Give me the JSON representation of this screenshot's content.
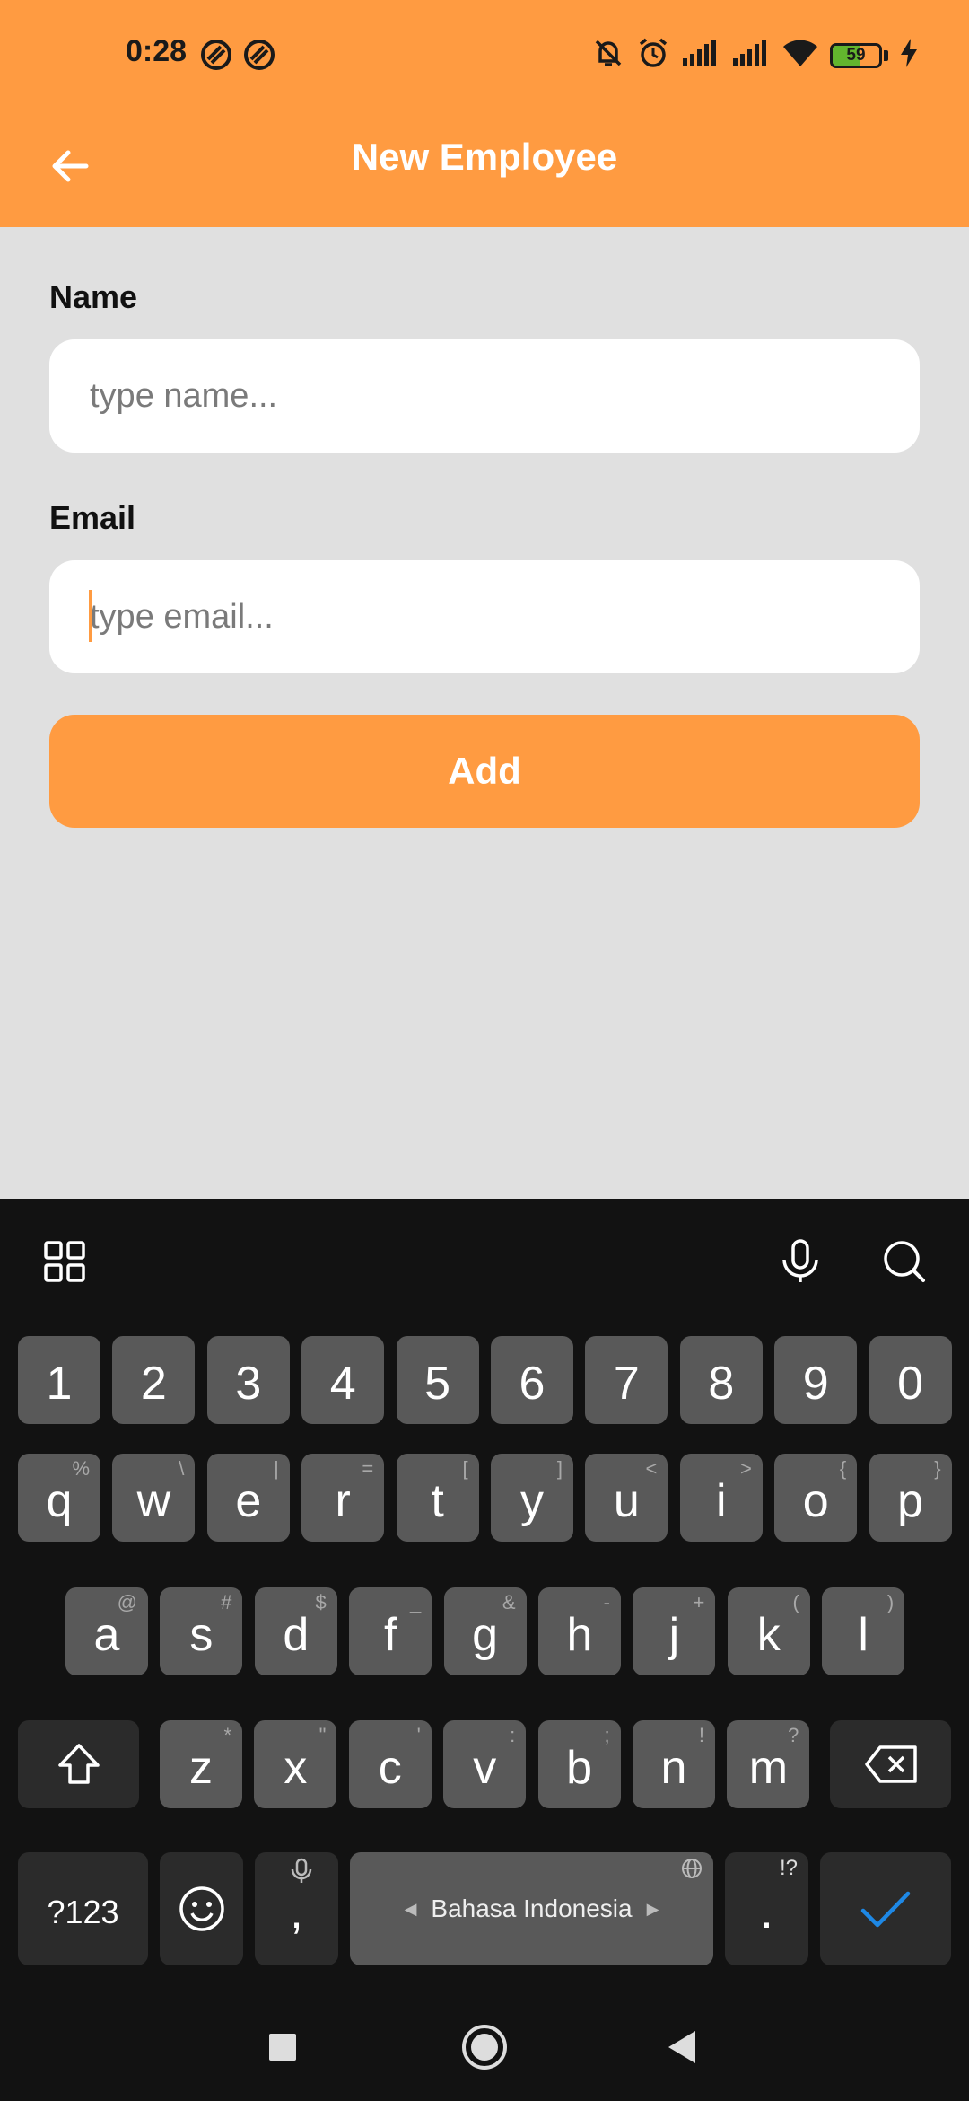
{
  "status_bar": {
    "time": "0:28",
    "battery_level": "59",
    "battery_fraction": 0.59,
    "icons": [
      "notification-icon",
      "notification-icon",
      "mute-bell-icon",
      "alarm-icon",
      "signal-icon",
      "signal-icon",
      "wifi-icon",
      "battery-icon",
      "charging-icon"
    ]
  },
  "app_bar": {
    "title": "New Employee",
    "back_icon": "arrow-left-icon"
  },
  "form": {
    "name_label": "Name",
    "name_placeholder": "type name...",
    "name_value": "",
    "email_label": "Email",
    "email_placeholder": "type email...",
    "email_value": "",
    "add_label": "Add"
  },
  "keyboard": {
    "toolbar_icons": [
      "grid-icon",
      "microphone-icon",
      "search-icon"
    ],
    "number_row": [
      "1",
      "2",
      "3",
      "4",
      "5",
      "6",
      "7",
      "8",
      "9",
      "0"
    ],
    "row1": [
      {
        "key": "q",
        "hint": "%"
      },
      {
        "key": "w",
        "hint": "\\"
      },
      {
        "key": "e",
        "hint": "|"
      },
      {
        "key": "r",
        "hint": "="
      },
      {
        "key": "t",
        "hint": "["
      },
      {
        "key": "y",
        "hint": "]"
      },
      {
        "key": "u",
        "hint": "<"
      },
      {
        "key": "i",
        "hint": ">"
      },
      {
        "key": "o",
        "hint": "{"
      },
      {
        "key": "p",
        "hint": "}"
      }
    ],
    "row2": [
      {
        "key": "a",
        "hint": "@"
      },
      {
        "key": "s",
        "hint": "#"
      },
      {
        "key": "d",
        "hint": "$"
      },
      {
        "key": "f",
        "hint": "_"
      },
      {
        "key": "g",
        "hint": "&"
      },
      {
        "key": "h",
        "hint": "-"
      },
      {
        "key": "j",
        "hint": "+"
      },
      {
        "key": "k",
        "hint": "("
      },
      {
        "key": "l",
        "hint": ")"
      }
    ],
    "row3": [
      {
        "key": "z",
        "hint": "*"
      },
      {
        "key": "x",
        "hint": "\""
      },
      {
        "key": "c",
        "hint": "'"
      },
      {
        "key": "v",
        "hint": ":"
      },
      {
        "key": "b",
        "hint": ";"
      },
      {
        "key": "n",
        "hint": "!"
      },
      {
        "key": "m",
        "hint": "?"
      }
    ],
    "symbols_label": "?123",
    "comma": ",",
    "space_label": "Bahasa Indonesia",
    "period": ".",
    "period_hint": "!?",
    "accent_color": "#1e88e5"
  },
  "colors": {
    "primary": "#ff9b41",
    "background": "#e0e0e0",
    "keyboard_bg": "#121212",
    "key_bg": "#595959"
  }
}
